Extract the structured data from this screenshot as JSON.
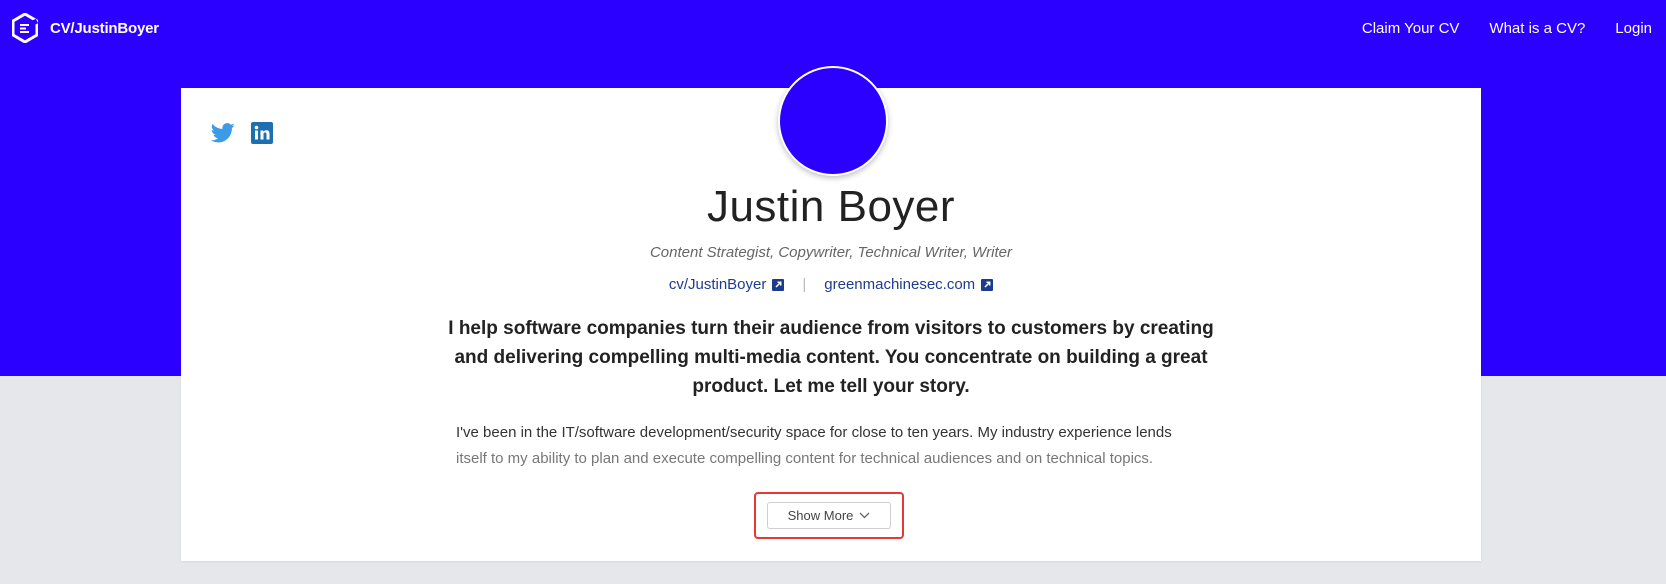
{
  "nav": {
    "brand": "CV/JustinBoyer",
    "links": [
      "Claim Your CV",
      "What is a CV?",
      "Login"
    ]
  },
  "social": {
    "icons": [
      "twitter-icon",
      "linkedin-icon"
    ]
  },
  "profile": {
    "name": "Justin Boyer",
    "tagline": "Content Strategist, Copywriter, Technical Writer, Writer",
    "links": [
      "cv/JustinBoyer",
      "greenmachinesec.com"
    ],
    "separator": "|",
    "headline": "I help software companies turn their audience from visitors to customers by creating and delivering compelling multi-media content. You concentrate on building a great product. Let me tell your story.",
    "bio_line1": "I've been in the IT/software development/security space for close to ten years. My industry experience lends",
    "bio_line2": "itself to my ability to plan and execute compelling content for technical audiences and on technical topics.",
    "show_more": "Show More"
  },
  "colors": {
    "hero": "#2b00ff",
    "link": "#1d3c8f",
    "twitter": "#3b9be6",
    "linkedin": "#1d6fb0",
    "highlight": "#e53935"
  }
}
